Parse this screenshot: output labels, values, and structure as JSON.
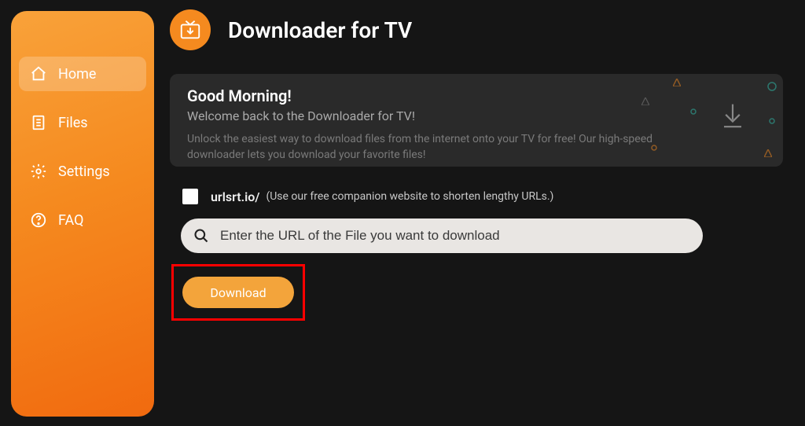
{
  "header": {
    "title": "Downloader for TV"
  },
  "sidebar": {
    "items": [
      {
        "label": "Home",
        "active": true
      },
      {
        "label": "Files",
        "active": false
      },
      {
        "label": "Settings",
        "active": false
      },
      {
        "label": "FAQ",
        "active": false
      }
    ]
  },
  "welcome": {
    "title": "Good Morning!",
    "subtitle": "Welcome back to the Downloader for TV!",
    "description": "Unlock the easiest way to download files from the internet onto your TV for free! Our high-speed downloader lets you download your favorite files!"
  },
  "shorten": {
    "prefix": "urlsrt.io/",
    "hint": "(Use our free companion website to shorten lengthy URLs.)"
  },
  "search": {
    "placeholder": "Enter the URL of the File you want to download"
  },
  "actions": {
    "download": "Download"
  }
}
